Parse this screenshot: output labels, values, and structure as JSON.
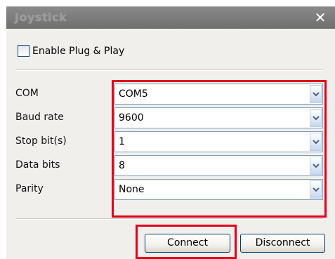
{
  "window": {
    "title": "Joystick",
    "close_label": "✕"
  },
  "plug_and_play": {
    "label": "Enable Plug & Play",
    "checked": false
  },
  "settings": [
    {
      "label": "COM",
      "value": "COM5"
    },
    {
      "label": "Baud rate",
      "value": "9600"
    },
    {
      "label": "Stop bit(s)",
      "value": "1"
    },
    {
      "label": "Data bits",
      "value": "8"
    },
    {
      "label": "Parity",
      "value": "None"
    }
  ],
  "buttons": {
    "connect": "Connect",
    "disconnect": "Disconnect"
  },
  "colors": {
    "highlight": "#e0001a",
    "titlebar": "#7d7d7d",
    "dialog_bg": "#f0efec"
  }
}
